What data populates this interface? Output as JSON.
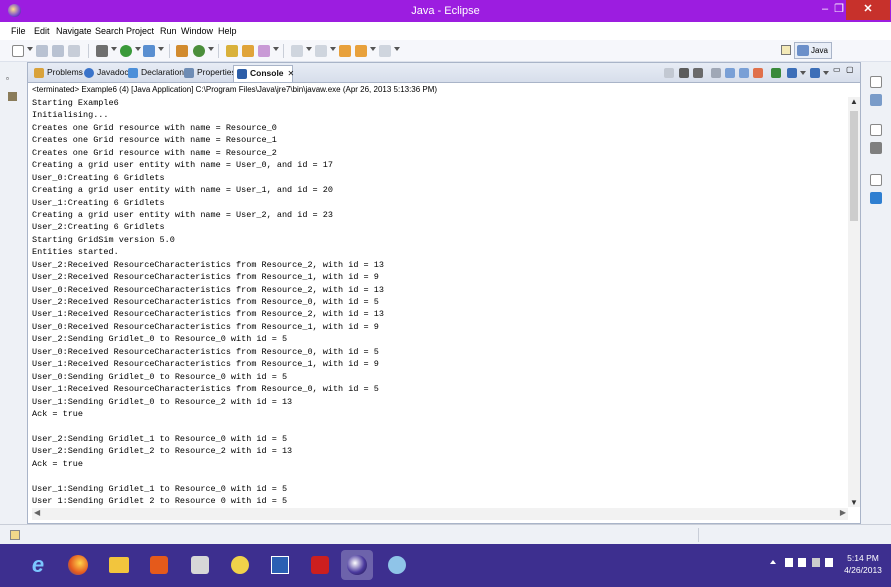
{
  "window": {
    "title": "Java - Eclipse",
    "minimize": "–",
    "restore": "❐",
    "close": "✕"
  },
  "menu": [
    "File",
    "Edit",
    "Navigate",
    "Search",
    "Project",
    "Run",
    "Window",
    "Help"
  ],
  "perspective": {
    "label": "Java"
  },
  "views": {
    "tabs": [
      {
        "label": "Problems",
        "icon": "problems-icon",
        "color": "#d9a23a"
      },
      {
        "label": "Javadoc",
        "icon": "javadoc-icon",
        "color": "#3a73c9"
      },
      {
        "label": "Declaration",
        "icon": "declaration-icon",
        "color": "#4c8fd9"
      },
      {
        "label": "Properties",
        "icon": "properties-icon",
        "color": "#6f8db5"
      },
      {
        "label": "Console",
        "icon": "console-icon",
        "color": "#2d5ea8",
        "close": "✕"
      }
    ]
  },
  "console": {
    "status": "<terminated> Example6 (4) [Java Application] C:\\Program Files\\Java\\jre7\\bin\\javaw.exe (Apr 26, 2013 5:13:36 PM)",
    "lines": [
      "Starting Example6",
      "Initialising...",
      "Creates one Grid resource with name = Resource_0",
      "Creates one Grid resource with name = Resource_1",
      "Creates one Grid resource with name = Resource_2",
      "Creating a grid user entity with name = User_0, and id = 17",
      "User_0:Creating 6 Gridlets",
      "Creating a grid user entity with name = User_1, and id = 20",
      "User_1:Creating 6 Gridlets",
      "Creating a grid user entity with name = User_2, and id = 23",
      "User_2:Creating 6 Gridlets",
      "Starting GridSim version 5.0",
      "Entities started.",
      "User_2:Received ResourceCharacteristics from Resource_2, with id = 13",
      "User_2:Received ResourceCharacteristics from Resource_1, with id = 9",
      "User_0:Received ResourceCharacteristics from Resource_2, with id = 13",
      "User_2:Received ResourceCharacteristics from Resource_0, with id = 5",
      "User_1:Received ResourceCharacteristics from Resource_2, with id = 13",
      "User_0:Received ResourceCharacteristics from Resource_1, with id = 9",
      "User_2:Sending Gridlet_0 to Resource_0 with id = 5",
      "User_0:Received ResourceCharacteristics from Resource_0, with id = 5",
      "User_1:Received ResourceCharacteristics from Resource_1, with id = 9",
      "User_0:Sending Gridlet_0 to Resource_0 with id = 5",
      "User_1:Received ResourceCharacteristics from Resource_0, with id = 5",
      "User_1:Sending Gridlet_0 to Resource_2 with id = 13",
      "Ack = true",
      "",
      "User_2:Sending Gridlet_1 to Resource_0 with id = 5",
      "User_2:Sending Gridlet_2 to Resource_2 with id = 13",
      "Ack = true",
      "",
      "User_1:Sending Gridlet_1 to Resource_0 with id = 5",
      "User 1:Sending Gridlet 2 to Resource 0 with id = 5"
    ]
  },
  "clock": {
    "time": "5:14 PM",
    "date": "4/26/2013"
  },
  "colors": {
    "titlebar": "#9c1de0",
    "taskbar": "#3d2f8f"
  }
}
